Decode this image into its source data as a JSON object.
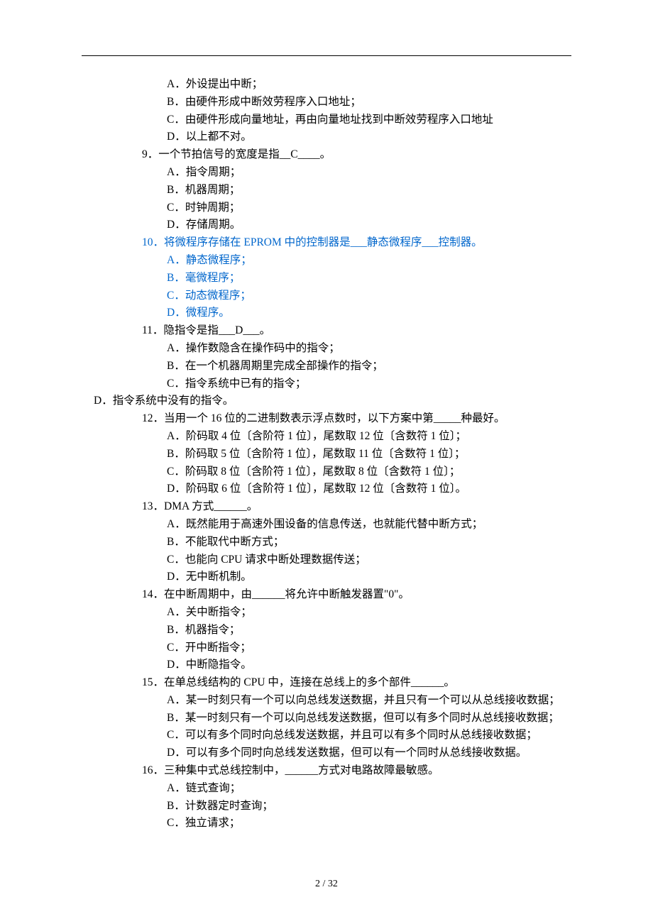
{
  "lines": [
    {
      "cls": "option",
      "text": "A．外设提出中断；"
    },
    {
      "cls": "option",
      "text": "B．由硬件形成中断效劳程序入口地址；"
    },
    {
      "cls": "option",
      "text": "C．由硬件形成向量地址，再由向量地址找到中断效劳程序入口地址"
    },
    {
      "cls": "option",
      "text": "D．以上都不对。"
    },
    {
      "cls": "question",
      "text": "9．一个节拍信号的宽度是指__C____。"
    },
    {
      "cls": "option",
      "text": "A．指令周期；"
    },
    {
      "cls": "option",
      "text": "B．机器周期；"
    },
    {
      "cls": "option",
      "text": "C．时钟周期；"
    },
    {
      "cls": "option",
      "text": "D．存储周期。"
    },
    {
      "cls": "question blue",
      "text": "10．将微程序存储在 EPROM 中的控制器是___静态微程序___控制器。"
    },
    {
      "cls": "option blue",
      "text": "A．静态微程序；"
    },
    {
      "cls": "option blue",
      "text": "B．毫微程序；"
    },
    {
      "cls": "option blue",
      "text": "C．动态微程序；"
    },
    {
      "cls": "option blue",
      "text": "D．微程序。"
    },
    {
      "cls": "question",
      "text": "11．隐指令是指___D___。"
    },
    {
      "cls": "option",
      "text": "A．操作数隐含在操作码中的指令；"
    },
    {
      "cls": "option",
      "text": "B．在一个机器周期里完成全部操作的指令；"
    },
    {
      "cls": "option",
      "text": "C．指令系统中已有的指令；"
    },
    {
      "cls": "outdent",
      "text": "D．指令系统中没有的指令。"
    },
    {
      "cls": "question",
      "text": "12．当用一个 16 位的二进制数表示浮点数时，以下方案中第_____种最好。"
    },
    {
      "cls": "option",
      "text": "A．阶码取 4 位〔含阶符 1 位〕，尾数取 12 位〔含数符 1 位〕；"
    },
    {
      "cls": "option",
      "text": "B．阶码取 5 位〔含阶符 1 位〕，尾数取 11 位〔含数符 1  位〕；"
    },
    {
      "cls": "option",
      "text": "C．阶码取 8 位〔含阶符 1 位〕，尾数取 8 位〔含数符 1 位〕；"
    },
    {
      "cls": "option",
      "text": "D．阶码取 6 位〔含阶符 1 位〕，尾数取 12 位〔含数符 1 位〕。"
    },
    {
      "cls": "question",
      "text": "13．DMA 方式______。"
    },
    {
      "cls": "option",
      "text": "A．既然能用于高速外围设备的信息传送，也就能代替中断方式；"
    },
    {
      "cls": "option",
      "text": "B．不能取代中断方式；"
    },
    {
      "cls": "option",
      "text": "C．也能向 CPU 请求中断处理数据传送；"
    },
    {
      "cls": "option",
      "text": "D．无中断机制。"
    },
    {
      "cls": "question",
      "text": "14．在中断周期中，由______将允许中断触发器置\"0\"。"
    },
    {
      "cls": "option",
      "text": "A．关中断指令；"
    },
    {
      "cls": "option",
      "text": "B．机器指令；"
    },
    {
      "cls": "option",
      "text": "C．开中断指令；"
    },
    {
      "cls": "option",
      "text": "D．中断隐指令。"
    },
    {
      "cls": "question",
      "text": "15．在单总线结构的 CPU 中，连接在总线上的多个部件______。"
    },
    {
      "cls": "option",
      "text": "A．某一时刻只有一个可以向总线发送数据，并且只有一个可以从总线接收数据；"
    },
    {
      "cls": "option",
      "text": "B．某一时刻只有一个可以向总线发送数据，但可以有多个同时从总线接收数据；"
    },
    {
      "cls": "option",
      "text": "C．可以有多个同时向总线发送数据，并且可以有多个同时从总线接收数据；"
    },
    {
      "cls": "option",
      "text": "D．可以有多个同时向总线发送数据，但可以有一个同时从总线接收数据。"
    },
    {
      "cls": "question",
      "text": "16．三种集中式总线控制中，______方式对电路故障最敏感。"
    },
    {
      "cls": "option",
      "text": "A．链式查询；"
    },
    {
      "cls": "option",
      "text": "B．计数器定时查询；"
    },
    {
      "cls": "option",
      "text": "C．独立请求；"
    }
  ],
  "footer": "2 / 32"
}
